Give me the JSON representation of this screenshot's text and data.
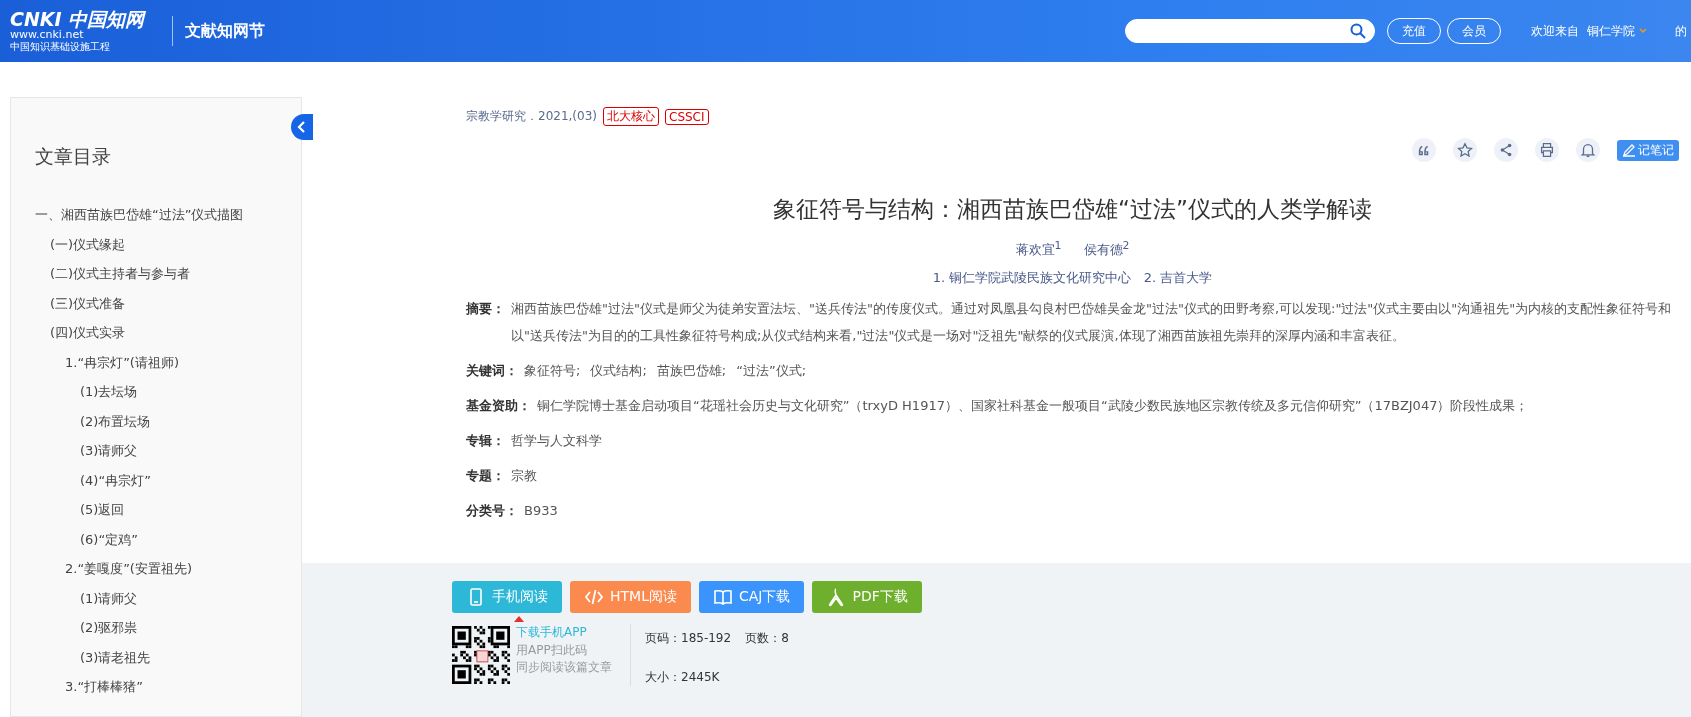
{
  "header": {
    "logo": {
      "mark": "CNKI",
      "brand": "中国知网",
      "url": "www.cnki.net",
      "tagline": "中国知识基础设施工程"
    },
    "section_title": "文献知网节",
    "buttons": [
      "充值",
      "会员"
    ],
    "welcome": "欢迎来自",
    "institution": "铜仁学院",
    "cut_text": "的"
  },
  "sidebar": {
    "title": "文章目录",
    "toc": [
      {
        "label": "一、湘西苗族巴岱雄“过法”仪式描图",
        "children": [
          {
            "label": "(一)仪式缘起"
          },
          {
            "label": "(二)仪式主持者与参与者"
          },
          {
            "label": "(三)仪式准备"
          },
          {
            "label": "(四)仪式实录",
            "children": [
              {
                "label": "1.“冉宗灯”(请祖师)",
                "children": [
                  {
                    "label": "(1)去坛场"
                  },
                  {
                    "label": "(2)布置坛场"
                  },
                  {
                    "label": "(3)请师父"
                  },
                  {
                    "label": "(4)“冉宗灯”"
                  },
                  {
                    "label": "(5)返回"
                  },
                  {
                    "label": "(6)“定鸡”"
                  }
                ]
              },
              {
                "label": "2.“姜嘎度”(安置祖先)",
                "children": [
                  {
                    "label": "(1)请师父"
                  },
                  {
                    "label": "(2)驱邪祟"
                  },
                  {
                    "label": "(3)请老祖先"
                  }
                ]
              },
              {
                "label": "3.“打棒棒猪”"
              }
            ]
          }
        ]
      }
    ]
  },
  "article": {
    "source": "宗教学研究．2021,(03)",
    "tags": [
      "北大核心",
      "CSSCI"
    ],
    "actions": [
      {
        "kind": "quote"
      },
      {
        "kind": "star"
      },
      {
        "kind": "share"
      },
      {
        "kind": "print"
      },
      {
        "kind": "bell"
      }
    ],
    "note_button": "记笔记",
    "title": "象征符号与结构：湘西苗族巴岱雄“过法”仪式的人类学解读",
    "authors": [
      "蒋欢宜$^{1}$",
      "侯有德$^{2}$"
    ],
    "affiliations": "1. 铜仁学院武陵民族文化研究中心   2. 吉首大学",
    "fields": [
      {
        "label": "摘要：",
        "kind": "text",
        "value": "湘西苗族巴岱雄\"过法\"仪式是师父为徒弟安置法坛、\"送兵传法\"的传度仪式。通过对凤凰县勾良村巴岱雄吴金龙\"过法\"仪式的田野考察,可以发现:\"过法\"仪式主要由以\"沟通祖先\"为内核的支配性象征符号和以\"送兵传法\"为目的的工具性象征符号构成;从仪式结构来看,\"过法\"仪式是一场对\"泛祖先\"献祭的仪式展演,体现了湘西苗族祖先崇拜的深厚内涵和丰富表征。"
      },
      {
        "label": "关键词：",
        "kind": "links",
        "items": [
          "象征符号;",
          "仪式结构;",
          "苗族巴岱雄;",
          "“过法”仪式;"
        ]
      },
      {
        "label": "基金资助：",
        "kind": "text",
        "value": "铜仁学院博士基金启动项目“花瑶社会历史与文化研究”（trxyD H1917）、国家社科基金一般项目“武陵少数民族地区宗教传统及多元信仰研究”（17BZJ047）阶段性成果；"
      },
      {
        "label": "专辑：",
        "kind": "text",
        "value": "哲学与人文科学"
      },
      {
        "label": "专题：",
        "kind": "text",
        "value": "宗教"
      },
      {
        "label": "分类号：",
        "kind": "text",
        "value": "B933"
      }
    ]
  },
  "downloads": {
    "buttons": [
      {
        "kind": "phone",
        "label": "手机阅读",
        "color": "#2eb8d8"
      },
      {
        "kind": "html",
        "label": "HTML阅读",
        "color": "#fb8a4f"
      },
      {
        "kind": "book",
        "label": "CAJ下载",
        "color": "#3a94fb"
      },
      {
        "kind": "pdf",
        "label": "PDF下载",
        "color": "#6faf2e"
      }
    ],
    "app": {
      "link": "下载手机APP",
      "hint_lines": [
        "用APP扫此码",
        "同步阅读该篇文章"
      ]
    },
    "info": {
      "pages": "页码：185-192",
      "page_count": "页数：8",
      "size": "大小：2445K"
    }
  }
}
